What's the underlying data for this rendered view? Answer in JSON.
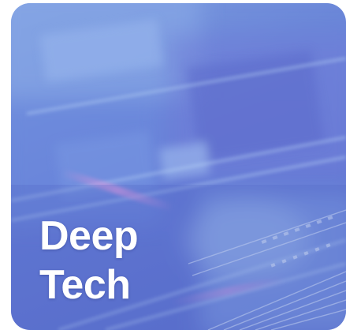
{
  "card": {
    "title_line_1": "Deep",
    "title_line_2": "Tech",
    "background_image": "microchip-circuit-photo",
    "accent_color": "#6a82d6",
    "text_color": "#ffffff"
  }
}
